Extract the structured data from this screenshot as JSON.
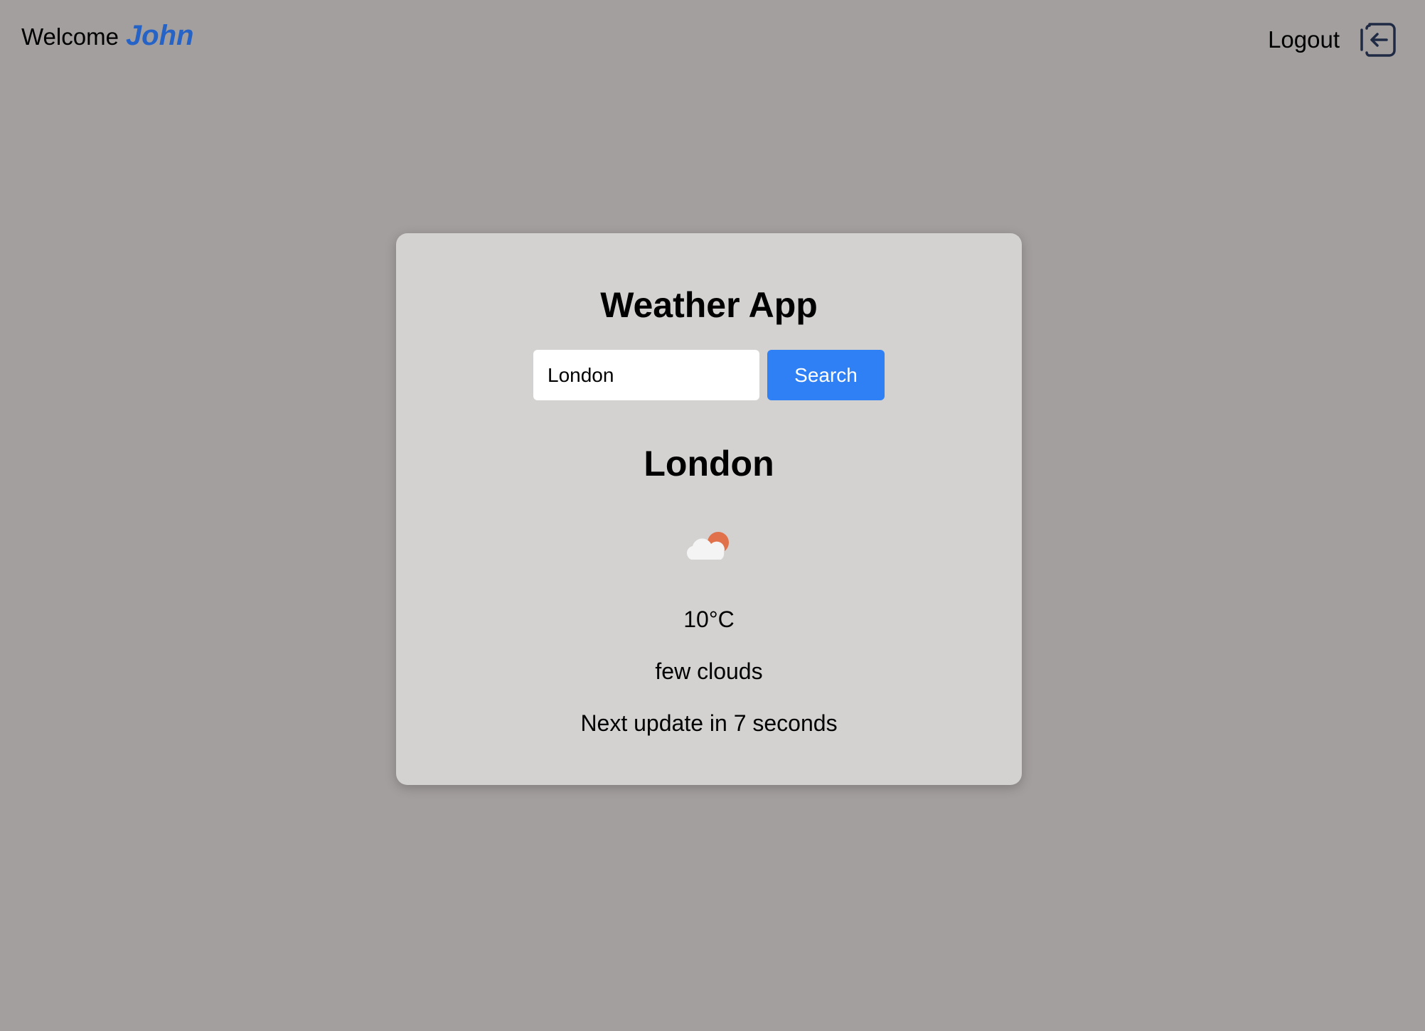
{
  "header": {
    "welcome_text": "Welcome",
    "username": "John",
    "logout_label": "Logout",
    "logout_icon": "logout-icon"
  },
  "weather": {
    "app_title": "Weather App",
    "search_value": "London",
    "search_button": "Search",
    "city": "London",
    "icon": "few-clouds-icon",
    "temperature": "10°C",
    "description": "few clouds",
    "next_update_text": "Next update in 7 seconds"
  },
  "colors": {
    "page_background": "#a49f9f",
    "card_background": "#d3d2d1",
    "accent_blue": "#2f80f5",
    "username_blue": "#2563c7",
    "sun_orange": "#e0714b"
  }
}
